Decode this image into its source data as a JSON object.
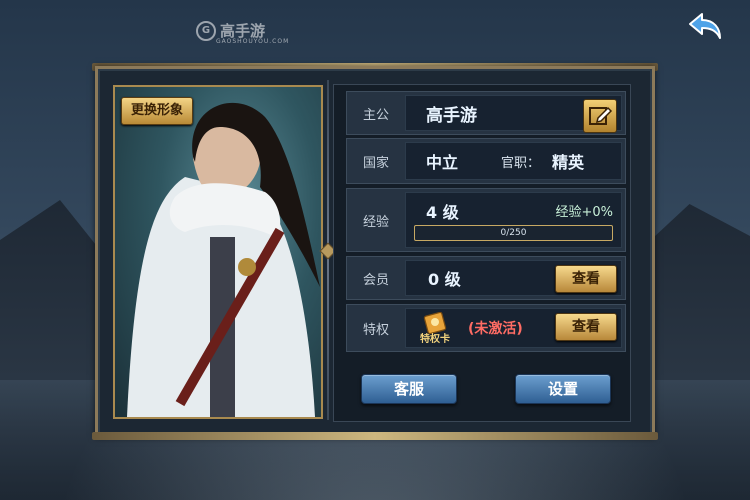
{
  "watermark": {
    "text": "高手游",
    "sub": "GAOSHOUYOU.COM"
  },
  "portrait": {
    "change_label": "更换形象"
  },
  "info": {
    "lord": {
      "label": "主公",
      "name": "高手游"
    },
    "country": {
      "label": "国家",
      "value": "中立",
      "office_label": "官职：",
      "office_value": "精英"
    },
    "exp": {
      "label": "经验",
      "level": "4 级",
      "bonus": "经验+0%",
      "current": 0,
      "max": 250,
      "bar_text": "0/250"
    },
    "vip": {
      "label": "会员",
      "level": "0 级",
      "view_label": "查看"
    },
    "privilege": {
      "label": "特权",
      "card_label": "特权卡",
      "status": "(未激活)",
      "view_label": "查看"
    }
  },
  "buttons": {
    "service": "客服",
    "settings": "设置"
  },
  "colors": {
    "accent_gold": "#f3d486",
    "button_blue": "#4c82b8",
    "inactive_red": "#ff6c64"
  },
  "icons": {
    "back": "back-arrow-icon",
    "edit": "edit-icon",
    "card": "privilege-card-icon"
  }
}
